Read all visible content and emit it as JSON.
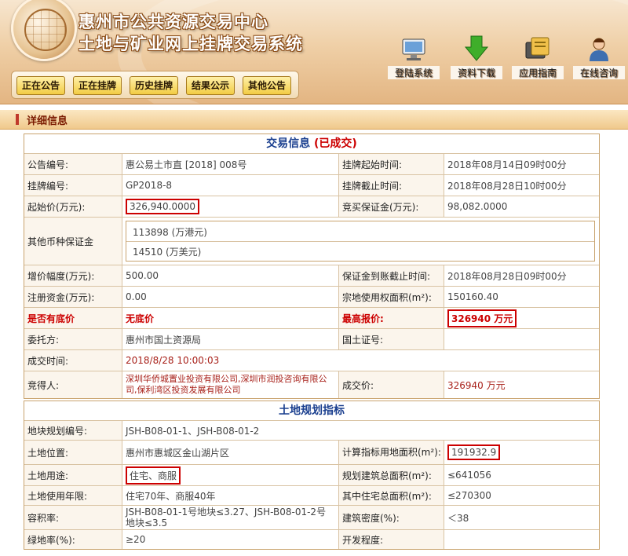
{
  "header": {
    "title_line1": "惠州市公共资源交易中心",
    "title_line2": "土地与矿业网上挂牌交易系统",
    "nav": [
      "正在公告",
      "正在挂牌",
      "历史挂牌",
      "结果公示",
      "其他公告"
    ],
    "tools": [
      {
        "label": "登陆系统",
        "icon": "monitor-icon"
      },
      {
        "label": "资料下载",
        "icon": "download-arrow-icon"
      },
      {
        "label": "应用指南",
        "icon": "guide-icon"
      },
      {
        "label": "在线咨询",
        "icon": "support-person-icon"
      }
    ]
  },
  "section_title": "详细信息",
  "trade": {
    "caption": "交易信息",
    "status": "(已成交)",
    "rows": {
      "notice_no_label": "公告编号:",
      "notice_no": "惠公易土市直 [2018] 008号",
      "start_time_label": "挂牌起始时间:",
      "start_time": "2018年08月14日09时00分",
      "listing_no_label": "挂牌编号:",
      "listing_no": "GP2018-8",
      "end_time_label": "挂牌截止时间:",
      "end_time": "2018年08月28日10时00分",
      "start_price_label": "起始价(万元):",
      "start_price": "326,940.0000",
      "deposit_label": "竞买保证金(万元):",
      "deposit": "98,082.0000",
      "other_deposit_label": "其他币种保证金",
      "other_deposit_hkd": "113898 (万港元)",
      "other_deposit_usd": "14510 (万美元)",
      "increment_label": "增价幅度(万元):",
      "increment": "500.00",
      "deposit_deadline_label": "保证金到账截止时间:",
      "deposit_deadline": "2018年08月28日09时00分",
      "capital_label": "注册资金(万元):",
      "capital": "0.00",
      "land_area_label": "宗地使用权面积(m²):",
      "land_area": "150160.40",
      "reserve_label": "是否有底价",
      "reserve": "无底价",
      "highest_label": "最高报价:",
      "highest": "326940 万元",
      "entrust_label": "委托方:",
      "entrust": "惠州市国土资源局",
      "cert_label": "国土证号:",
      "cert": "",
      "deal_time_label": "成交时间:",
      "deal_time": "2018/8/28 10:00:03",
      "winner_label": "竞得人:",
      "winner": "深圳华侨城置业投资有限公司,深圳市润投咨询有限公司,保利湾区投资发展有限公司",
      "deal_price_label": "成交价:",
      "deal_price": "326940 万元"
    }
  },
  "plan": {
    "caption": "土地规划指标",
    "rows": {
      "plot_no_label": "地块规划编号:",
      "plot_no": "JSH-B08-01-1、JSH-B08-01-2",
      "location_label": "土地位置:",
      "location": "惠州市惠城区金山湖片区",
      "calc_area_label": "计算指标用地面积(m²):",
      "calc_area": "191932.9",
      "use_label": "土地用途:",
      "use": "住宅、商服",
      "build_area_label": "规划建筑总面积(m²):",
      "build_area": "≤641056",
      "years_label": "土地使用年限:",
      "years": "住宅70年、商服40年",
      "res_area_label": "其中住宅总面积(m²):",
      "res_area": "≤270300",
      "far_label": "容积率:",
      "far": "JSH-B08-01-1号地块≤3.27、JSH-B08-01-2号地块≤3.5",
      "density_label": "建筑密度(%):",
      "density": "＜38",
      "green_label": "绿地率(%):",
      "green": "≥20",
      "dev_label": "开发程度:",
      "dev": ""
    }
  },
  "colors": {
    "accent": "#c00000",
    "caption": "#1a3f8f",
    "header": "#e3b582"
  }
}
